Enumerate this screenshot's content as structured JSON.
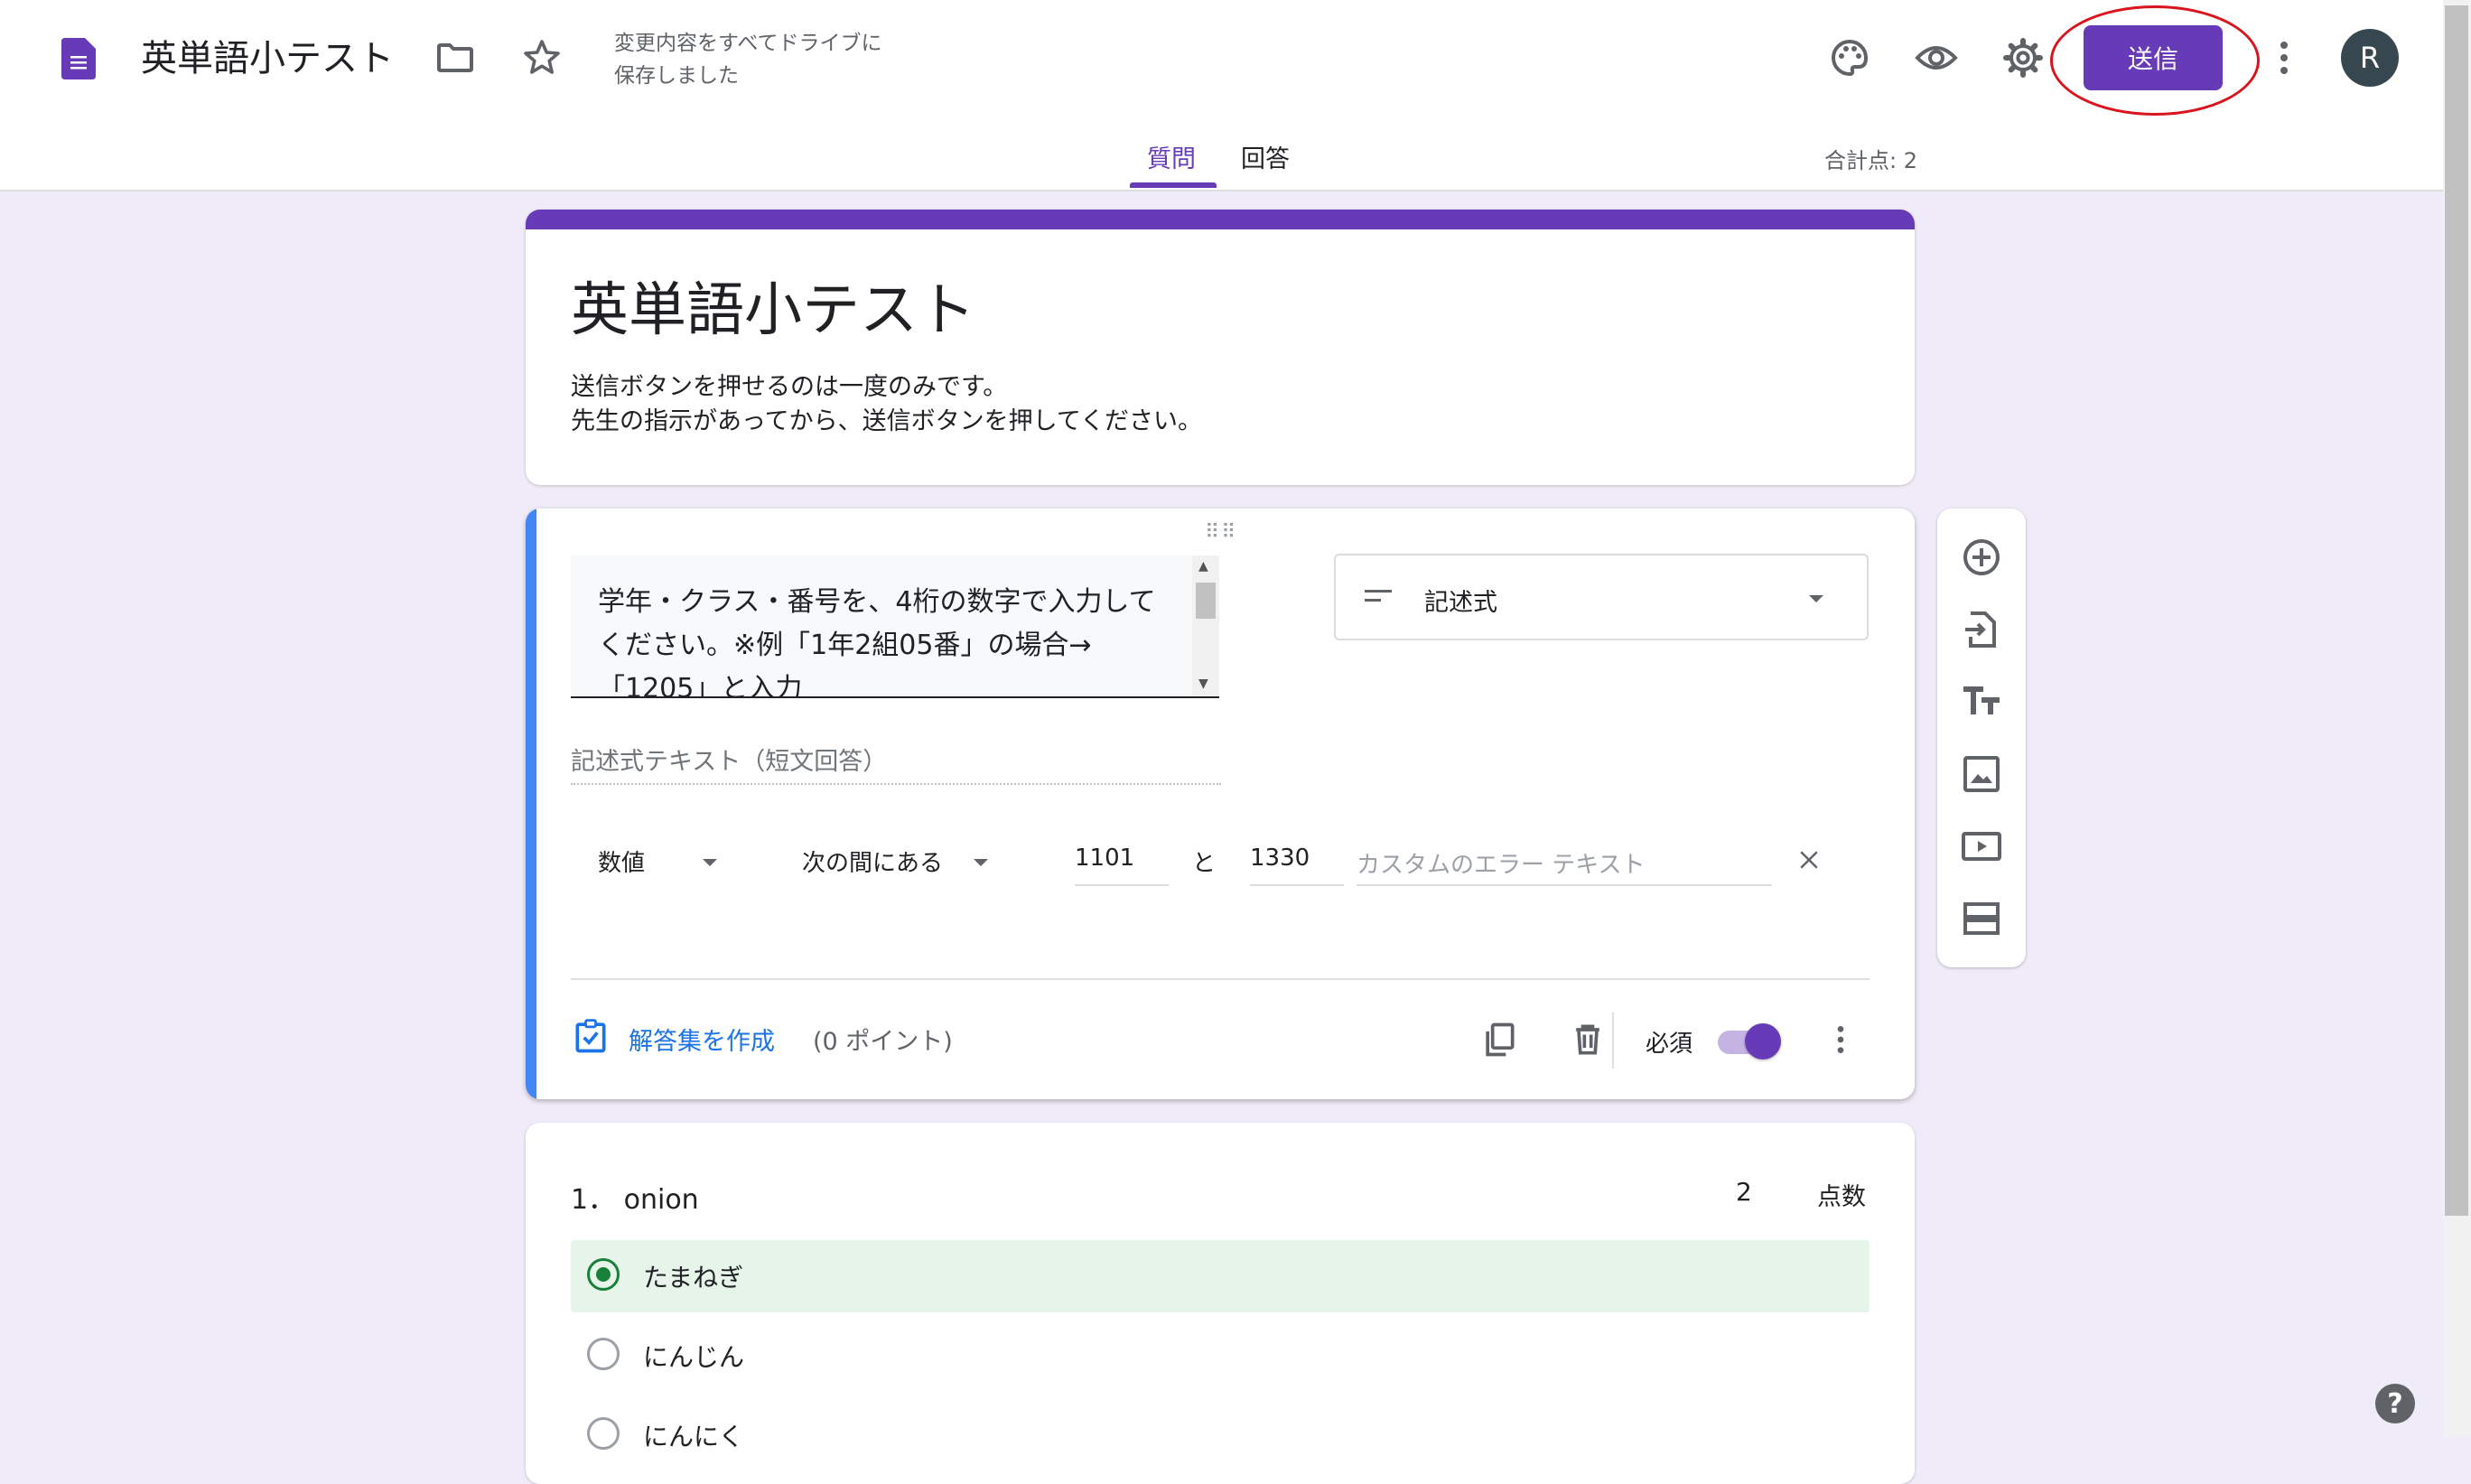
{
  "header": {
    "app_title": "英単語小テスト",
    "save_status_line1": "変更内容をすべてドライブに",
    "save_status_line2": "保存しました",
    "send_label": "送信",
    "avatar_letter": "R",
    "icons": [
      "docs-icon",
      "folder-icon",
      "star-icon",
      "palette-icon",
      "eye-icon",
      "gear-icon",
      "more-vert-icon"
    ]
  },
  "tabs": [
    {
      "label": "質問",
      "active": true
    },
    {
      "label": "回答",
      "active": false
    }
  ],
  "total_points": "合計点: 2",
  "form": {
    "title": "英単語小テスト",
    "description_line1": "送信ボタンを押せるのは一度のみです。",
    "description_line2": "先生の指示があってから、送信ボタンを押してください。"
  },
  "question1": {
    "text": "学年・クラス・番号を、4桁の数字で入力してください。※例「1年2組05番」の場合→「1205」と入力",
    "type_label": "記述式",
    "short_answer_placeholder": "記述式テキスト（短文回答）",
    "validation": {
      "kind": "数値",
      "condition": "次の間にある",
      "min": "1101",
      "and_label": "と",
      "max": "1330",
      "error_placeholder": "カスタムのエラー テキスト"
    },
    "answer_key_label": "解答集を作成",
    "points_label": "(0 ポイント)",
    "required_label": "必須",
    "required": true
  },
  "question2": {
    "title": "1． onion",
    "points": "2",
    "points_label": "点数",
    "options": [
      {
        "label": "たまねぎ",
        "correct": true
      },
      {
        "label": "にんじん",
        "correct": false
      },
      {
        "label": "にんにく",
        "correct": false
      }
    ]
  },
  "sidebar_icons": [
    "add-question-icon",
    "import-questions-icon",
    "add-title-icon",
    "add-image-icon",
    "add-video-icon",
    "add-section-icon"
  ],
  "colors": {
    "accent": "#673ab7",
    "background": "#f0ebf8",
    "focus_bar": "#4285f4",
    "correct": "#188038"
  }
}
